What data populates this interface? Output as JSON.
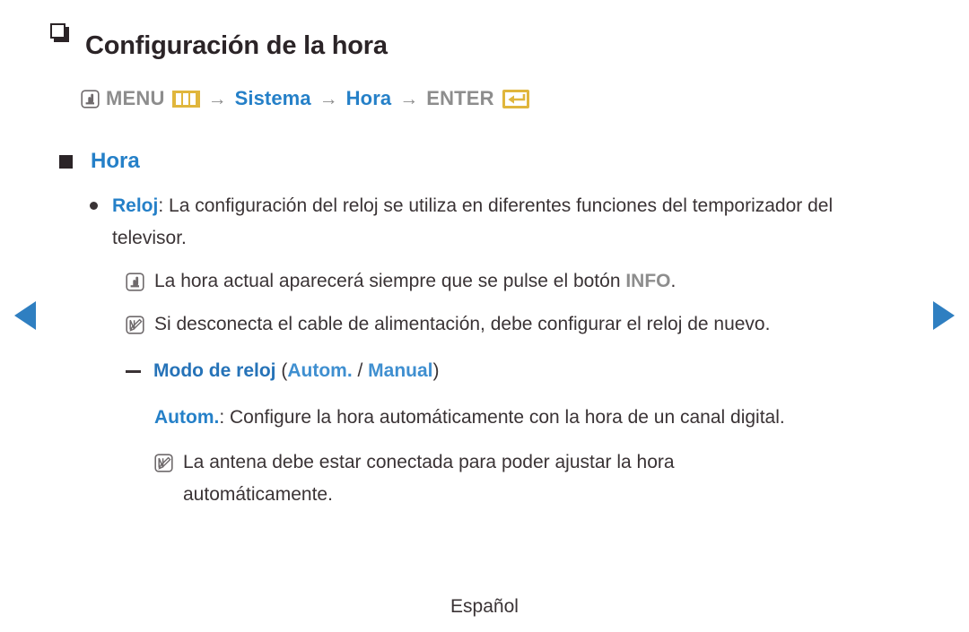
{
  "colors": {
    "accent_blue": "#2580c8",
    "accent_blue_dark": "#2673b8",
    "accent_blue_light": "#3f8fd0",
    "gold": "#e0b63c",
    "gray_text": "#8d8d8d",
    "body_text": "#3a3335"
  },
  "nav": {
    "prev_label": "previous page",
    "next_label": "next page"
  },
  "header": {
    "title": "Configuración de la hora",
    "bullet_icon": "box-outline-icon"
  },
  "menu_path": {
    "hand_icon": "hand-press-icon",
    "menu_label": "MENU",
    "menu_icon": "menu-bars-icon",
    "arrow1": "→",
    "item1": "Sistema",
    "arrow2": "→",
    "item2": "Hora",
    "arrow3": "→",
    "enter_label": "ENTER",
    "enter_icon": "enter-return-icon"
  },
  "section": {
    "bullet_icon": "filled-square-icon",
    "title": "Hora"
  },
  "body": {
    "reloj": {
      "bullet_icon": "dot-bullet-icon",
      "term": "Reloj",
      "separator": ": ",
      "text": "La configuración del reloj se utiliza en diferentes funciones del temporizador del televisor."
    },
    "note_info": {
      "icon": "hand-press-icon",
      "text_before": "La hora actual aparecerá siempre que se pulse el botón ",
      "keyword": "INFO",
      "text_after": "."
    },
    "note_power": {
      "icon": "note-pencil-icon",
      "text": "Si desconecta el cable de alimentación, debe configurar el reloj de nuevo."
    },
    "modo_reloj": {
      "dash_icon": "dash-bullet-icon",
      "term": "Modo de reloj",
      "paren_open": " (",
      "option1": "Autom.",
      "separator": " / ",
      "option2": "Manual",
      "paren_close": ")"
    },
    "autom_desc": {
      "term": "Autom.",
      "separator": ": ",
      "text": "Configure la hora automáticamente con la hora de un canal digital."
    },
    "note_antena": {
      "icon": "note-pencil-icon",
      "text": "La antena debe estar conectada para poder ajustar la hora automáticamente."
    }
  },
  "footer": {
    "language": "Español"
  }
}
